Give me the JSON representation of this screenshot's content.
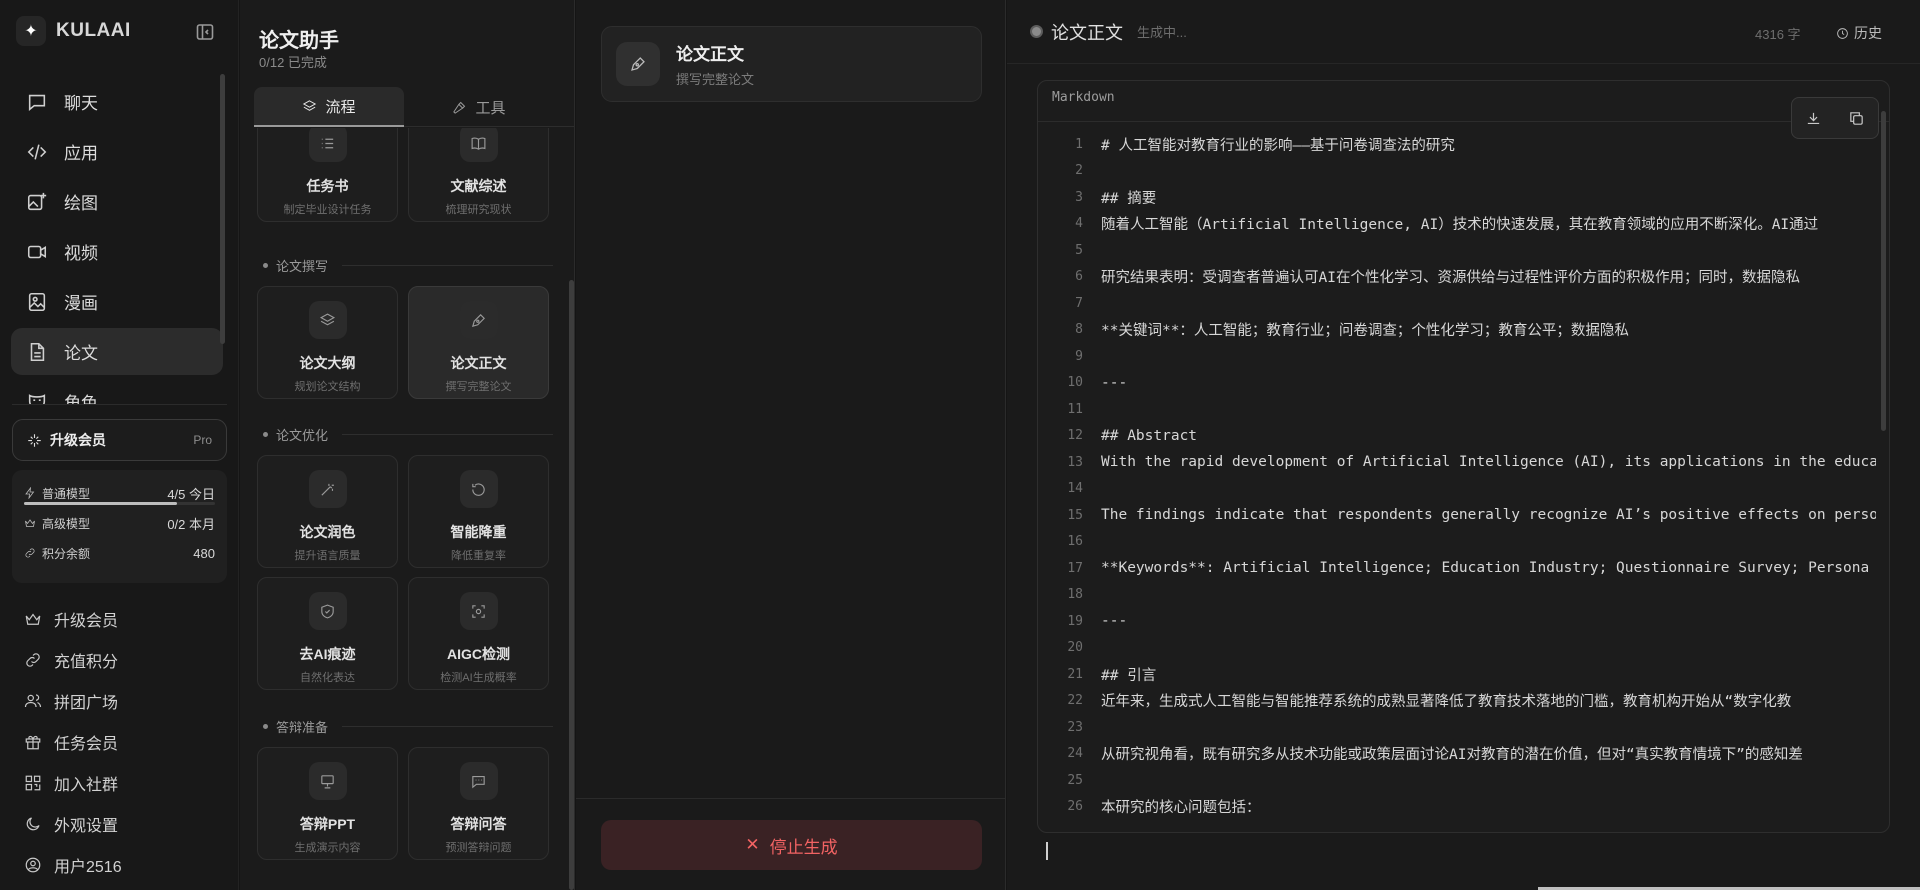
{
  "brand": {
    "name": "KULAAI"
  },
  "nav": {
    "items": [
      {
        "label": "聊天"
      },
      {
        "label": "应用"
      },
      {
        "label": "绘图"
      },
      {
        "label": "视频"
      },
      {
        "label": "漫画"
      },
      {
        "label": "论文"
      },
      {
        "label": "角色"
      }
    ]
  },
  "upgrade": {
    "label": "升级会员",
    "plan": "Pro"
  },
  "quota": {
    "normal": {
      "label": "普通模型",
      "value": "4/5 今日",
      "fill": 0.8
    },
    "advanced": {
      "label": "高级模型",
      "value": "0/2 本月"
    },
    "points": {
      "label": "积分余额",
      "value": "480"
    }
  },
  "menu": [
    {
      "label": "升级会员"
    },
    {
      "label": "充值积分"
    },
    {
      "label": "拼团广场"
    },
    {
      "label": "任务会员"
    },
    {
      "label": "加入社群"
    },
    {
      "label": "外观设置"
    },
    {
      "label": "用户2516"
    }
  ],
  "panel": {
    "title": "论文助手",
    "progress": "0/12 已完成",
    "tabs": [
      {
        "label": "流程"
      },
      {
        "label": "工具"
      }
    ],
    "cards_top": [
      {
        "name": "任务书",
        "desc": "制定毕业设计任务"
      },
      {
        "name": "文献综述",
        "desc": "梳理研究现状"
      }
    ],
    "sections": [
      {
        "title": "论文撰写",
        "cards": [
          {
            "name": "论文大纲",
            "desc": "规划论文结构"
          },
          {
            "name": "论文正文",
            "desc": "撰写完整论文"
          }
        ]
      },
      {
        "title": "论文优化",
        "cards": [
          {
            "name": "论文润色",
            "desc": "提升语言质量"
          },
          {
            "name": "智能降重",
            "desc": "降低重复率"
          },
          {
            "name": "去AI痕迹",
            "desc": "自然化表达"
          },
          {
            "name": "AIGC检测",
            "desc": "检测AI生成概率"
          }
        ]
      },
      {
        "title": "答辩准备",
        "cards": [
          {
            "name": "答辩PPT",
            "desc": "生成演示内容"
          },
          {
            "name": "答辩问答",
            "desc": "预测答辩问题"
          }
        ]
      }
    ]
  },
  "task": {
    "name": "论文正文",
    "desc": "撰写完整论文"
  },
  "stop_label": "停止生成",
  "editor": {
    "title": "论文正文",
    "status": "生成中...",
    "count": "4316 字",
    "history": "历史",
    "lang": "Markdown",
    "lines": [
      {
        "n": "1",
        "t": "# 人工智能对教育行业的影响——基于问卷调查法的研究"
      },
      {
        "n": "2",
        "t": ""
      },
      {
        "n": "3",
        "t": "## 摘要"
      },
      {
        "n": "4",
        "t": "随着人工智能（Artificial Intelligence, AI）技术的快速发展，其在教育领域的应用不断深化。AI通过"
      },
      {
        "n": "5",
        "t": ""
      },
      {
        "n": "6",
        "t": "研究结果表明：受调查者普遍认可AI在个性化学习、资源供给与过程性评价方面的积极作用；同时，数据隐私"
      },
      {
        "n": "7",
        "t": ""
      },
      {
        "n": "8",
        "t": "**关键词**：人工智能；教育行业；问卷调查；个性化学习；教育公平；数据隐私"
      },
      {
        "n": "9",
        "t": ""
      },
      {
        "n": "10",
        "t": "---"
      },
      {
        "n": "11",
        "t": ""
      },
      {
        "n": "12",
        "t": "## Abstract"
      },
      {
        "n": "13",
        "t": "With the rapid development of Artificial Intelligence (AI), its applications in the educa"
      },
      {
        "n": "14",
        "t": ""
      },
      {
        "n": "15",
        "t": "The findings indicate that respondents generally recognize AI’s positive effects on perso"
      },
      {
        "n": "16",
        "t": ""
      },
      {
        "n": "17",
        "t": "**Keywords**: Artificial Intelligence; Education Industry; Questionnaire Survey; Persona"
      },
      {
        "n": "18",
        "t": ""
      },
      {
        "n": "19",
        "t": "---"
      },
      {
        "n": "20",
        "t": ""
      },
      {
        "n": "21",
        "t": "## 引言"
      },
      {
        "n": "22",
        "t": "近年来，生成式人工智能与智能推荐系统的成熟显著降低了教育技术落地的门槛，教育机构开始从“数字化教"
      },
      {
        "n": "23",
        "t": ""
      },
      {
        "n": "24",
        "t": "从研究视角看，既有研究多从技术功能或政策层面讨论AI对教育的潜在价值，但对“真实教育情境下”的感知差"
      },
      {
        "n": "25",
        "t": ""
      },
      {
        "n": "26",
        "t": "本研究的核心问题包括："
      }
    ]
  }
}
